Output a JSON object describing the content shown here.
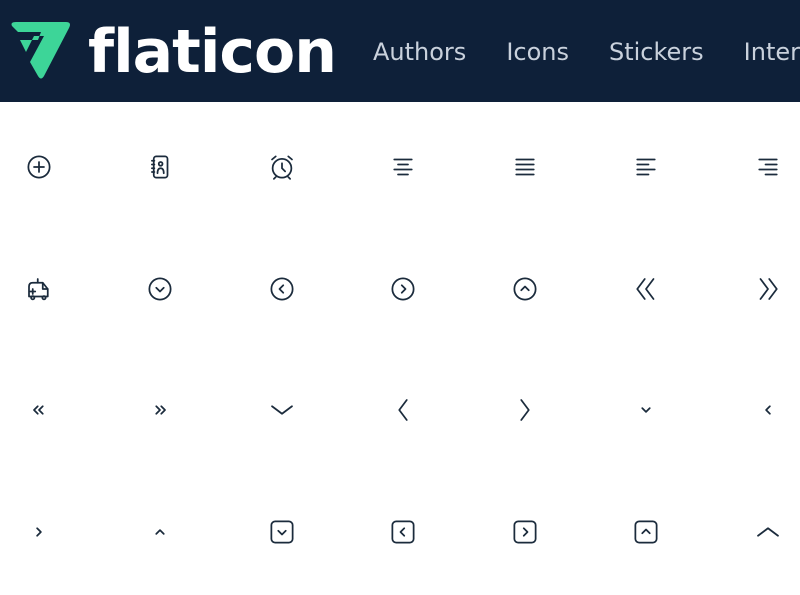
{
  "header": {
    "brand": "flaticon",
    "brand_color": "#3dd598",
    "background": "#0e2039",
    "nav": [
      "Authors",
      "Icons",
      "Stickers",
      "Interfaces"
    ]
  },
  "icon_color": "#1b2b3c",
  "icons": [
    [
      "add-circle",
      "address-book",
      "alarm-clock",
      "align-center",
      "align-justify",
      "align-left",
      "align-right"
    ],
    [
      "ambulance",
      "angle-circle-down",
      "angle-circle-left",
      "angle-circle-right",
      "angle-circle-up",
      "angle-double-left",
      "angle-double-right"
    ],
    [
      "angle-double-small-left",
      "angle-double-small-right",
      "angle-down",
      "angle-left",
      "angle-right",
      "angle-small-down",
      "angle-small-left"
    ],
    [
      "angle-small-right",
      "angle-small-up",
      "angle-square-down",
      "angle-square-left",
      "angle-square-right",
      "angle-square-up",
      "angle-up"
    ]
  ]
}
